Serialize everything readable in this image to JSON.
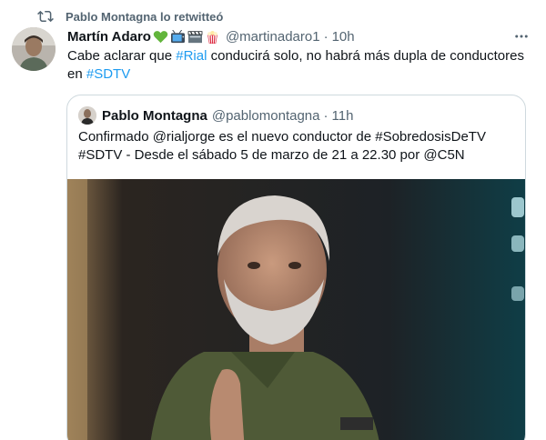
{
  "retweet": {
    "icon": "retweet-icon",
    "text": "Pablo Montagna lo retwitteó"
  },
  "tweet": {
    "author": {
      "name": "Martín Adaro",
      "emoji_icons": [
        "green-heart-icon",
        "television-icon",
        "film-clapper-icon",
        "popcorn-icon"
      ],
      "handle": "@martinadaro1",
      "separator": "·",
      "time": "10h"
    },
    "more_icon": "more-options-icon",
    "text": {
      "p1": "Cabe aclarar que ",
      "hashtag1": "#Rial",
      "p2": " conducirá solo, no habrá más dupla de conductores en ",
      "hashtag2": "#SDTV"
    }
  },
  "quoted": {
    "author": {
      "name": "Pablo Montagna",
      "handle": "@pablomontagna",
      "separator": "·",
      "time": "11h"
    },
    "text": "Confirmado @rialjorge es el nuevo conductor de #SobredosisDeTV #SDTV - Desde el sábado 5 de marzo de 21 a 22.30 por @C5N",
    "media": "photo-of-man-with-gray-beard"
  },
  "colors": {
    "text": "#0f1419",
    "secondary": "#536471",
    "link": "#1d9bf0",
    "border": "#cfd9de",
    "green_heart": "#62b53c"
  }
}
